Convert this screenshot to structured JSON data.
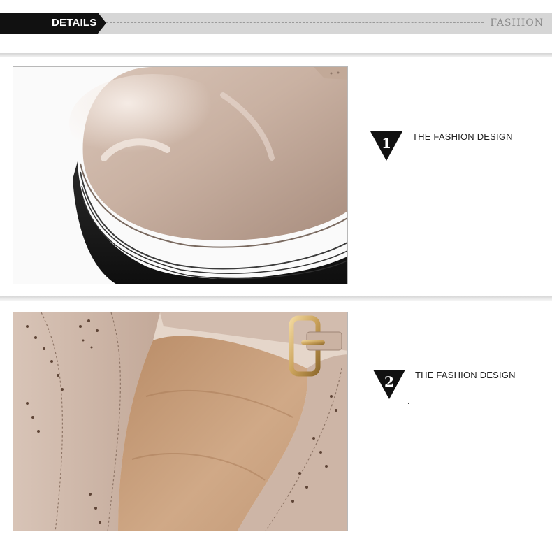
{
  "header": {
    "title": "DETAILS",
    "right_label": "FASHION"
  },
  "features": [
    {
      "number": "1",
      "label": "THE FASHION DESIGN"
    },
    {
      "number": "2",
      "label": "THE FASHION DESIGN"
    }
  ],
  "colors": {
    "header_black": "#111111",
    "header_grey": "#d6d6d6",
    "patent_nude": "#cdb6a6",
    "sole_black": "#1a1a1a",
    "lining_tan": "#c79a74",
    "buckle_gold": "#c9a15a"
  }
}
